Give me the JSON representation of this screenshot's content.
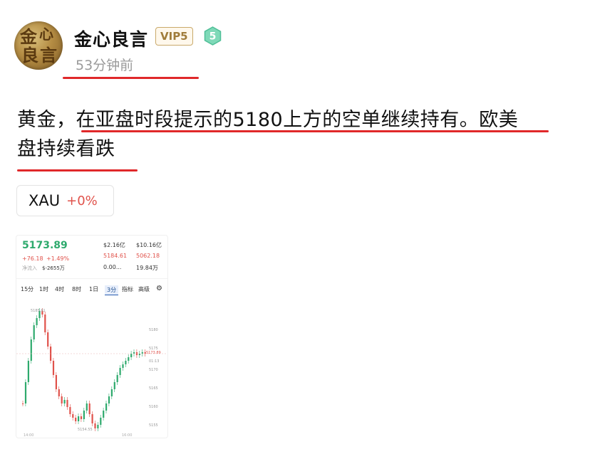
{
  "user": {
    "name": "金心良言",
    "avatar_text": [
      "金",
      "心",
      "良",
      "言"
    ],
    "vip_badge": "VIP5",
    "level": "5",
    "time_ago": "53分钟前"
  },
  "post": {
    "text_plain1": "黄金，",
    "text_plain2": "在亚盘时段提示的5180上方的空单继续持有。欧美",
    "text_plain3": "盘持续看跌"
  },
  "ticker_chip": {
    "symbol": "XAU",
    "change": "+0%"
  },
  "chart_thumbnail": {
    "price": "5173.89",
    "change_abs": "+76.18",
    "change_pct": "+1.49%",
    "flow_label": "净流入",
    "flow_value": "$-2655万",
    "stat1": "$2.16亿",
    "stat2": "$10.16亿",
    "high": "5184.61",
    "low": "5062.18",
    "stat5": "0.00...",
    "stat6": "19.84万",
    "tabs": [
      "15分",
      "1时",
      "4时",
      "8时",
      "1日",
      "3分",
      "指标",
      "高级"
    ],
    "active_tab": "3分",
    "price_axis": [
      "5180",
      "5175",
      "5170",
      "5165",
      "5160",
      "5155"
    ],
    "last_price_tag": "5173.89",
    "countdown": "01:13",
    "high_marker": "5185.61",
    "low_marker": "5154.55",
    "time_axis": [
      "14:00",
      "16:00"
    ],
    "colors": {
      "up": "#2eaa6d",
      "down": "#e0524b"
    }
  }
}
